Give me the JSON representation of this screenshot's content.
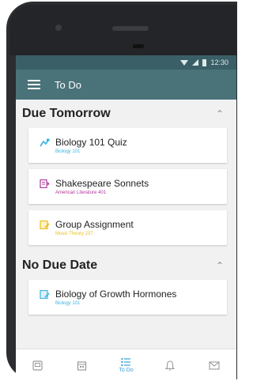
{
  "status_bar": {
    "time": "12:30"
  },
  "app_bar": {
    "title": "To Do"
  },
  "sections": [
    {
      "title": "Due Tomorrow",
      "collapse_icon": "chevron-up",
      "items": [
        {
          "title": "Biology 101 Quiz",
          "course": "Biology 101",
          "icon": "quiz-icon",
          "color": "#39b3e0"
        },
        {
          "title": "Shakespeare Sonnets",
          "course": "American Literature 401",
          "icon": "reading-icon",
          "color": "#b0379b"
        },
        {
          "title": "Group Assignment",
          "course": "Music Theory 237",
          "icon": "assignment-icon",
          "color": "#e8bd1c"
        }
      ]
    },
    {
      "title": "No Due Date",
      "collapse_icon": "chevron-up",
      "items": [
        {
          "title": "Biology of Growth Hormones",
          "course": "Biology 101",
          "icon": "assignment-icon",
          "color": "#39b3e0"
        }
      ]
    }
  ],
  "bottom_nav": [
    {
      "icon": "dashboard-icon",
      "label": ""
    },
    {
      "icon": "calendar-icon",
      "label": ""
    },
    {
      "icon": "todo-list-icon",
      "label": "To Do",
      "active": true
    },
    {
      "icon": "bell-icon",
      "label": ""
    },
    {
      "icon": "inbox-icon",
      "label": ""
    }
  ],
  "colors": {
    "app_bar": "#4a7279",
    "status_bar": "#3b5f66",
    "active_nav": "#3aa0d9"
  }
}
